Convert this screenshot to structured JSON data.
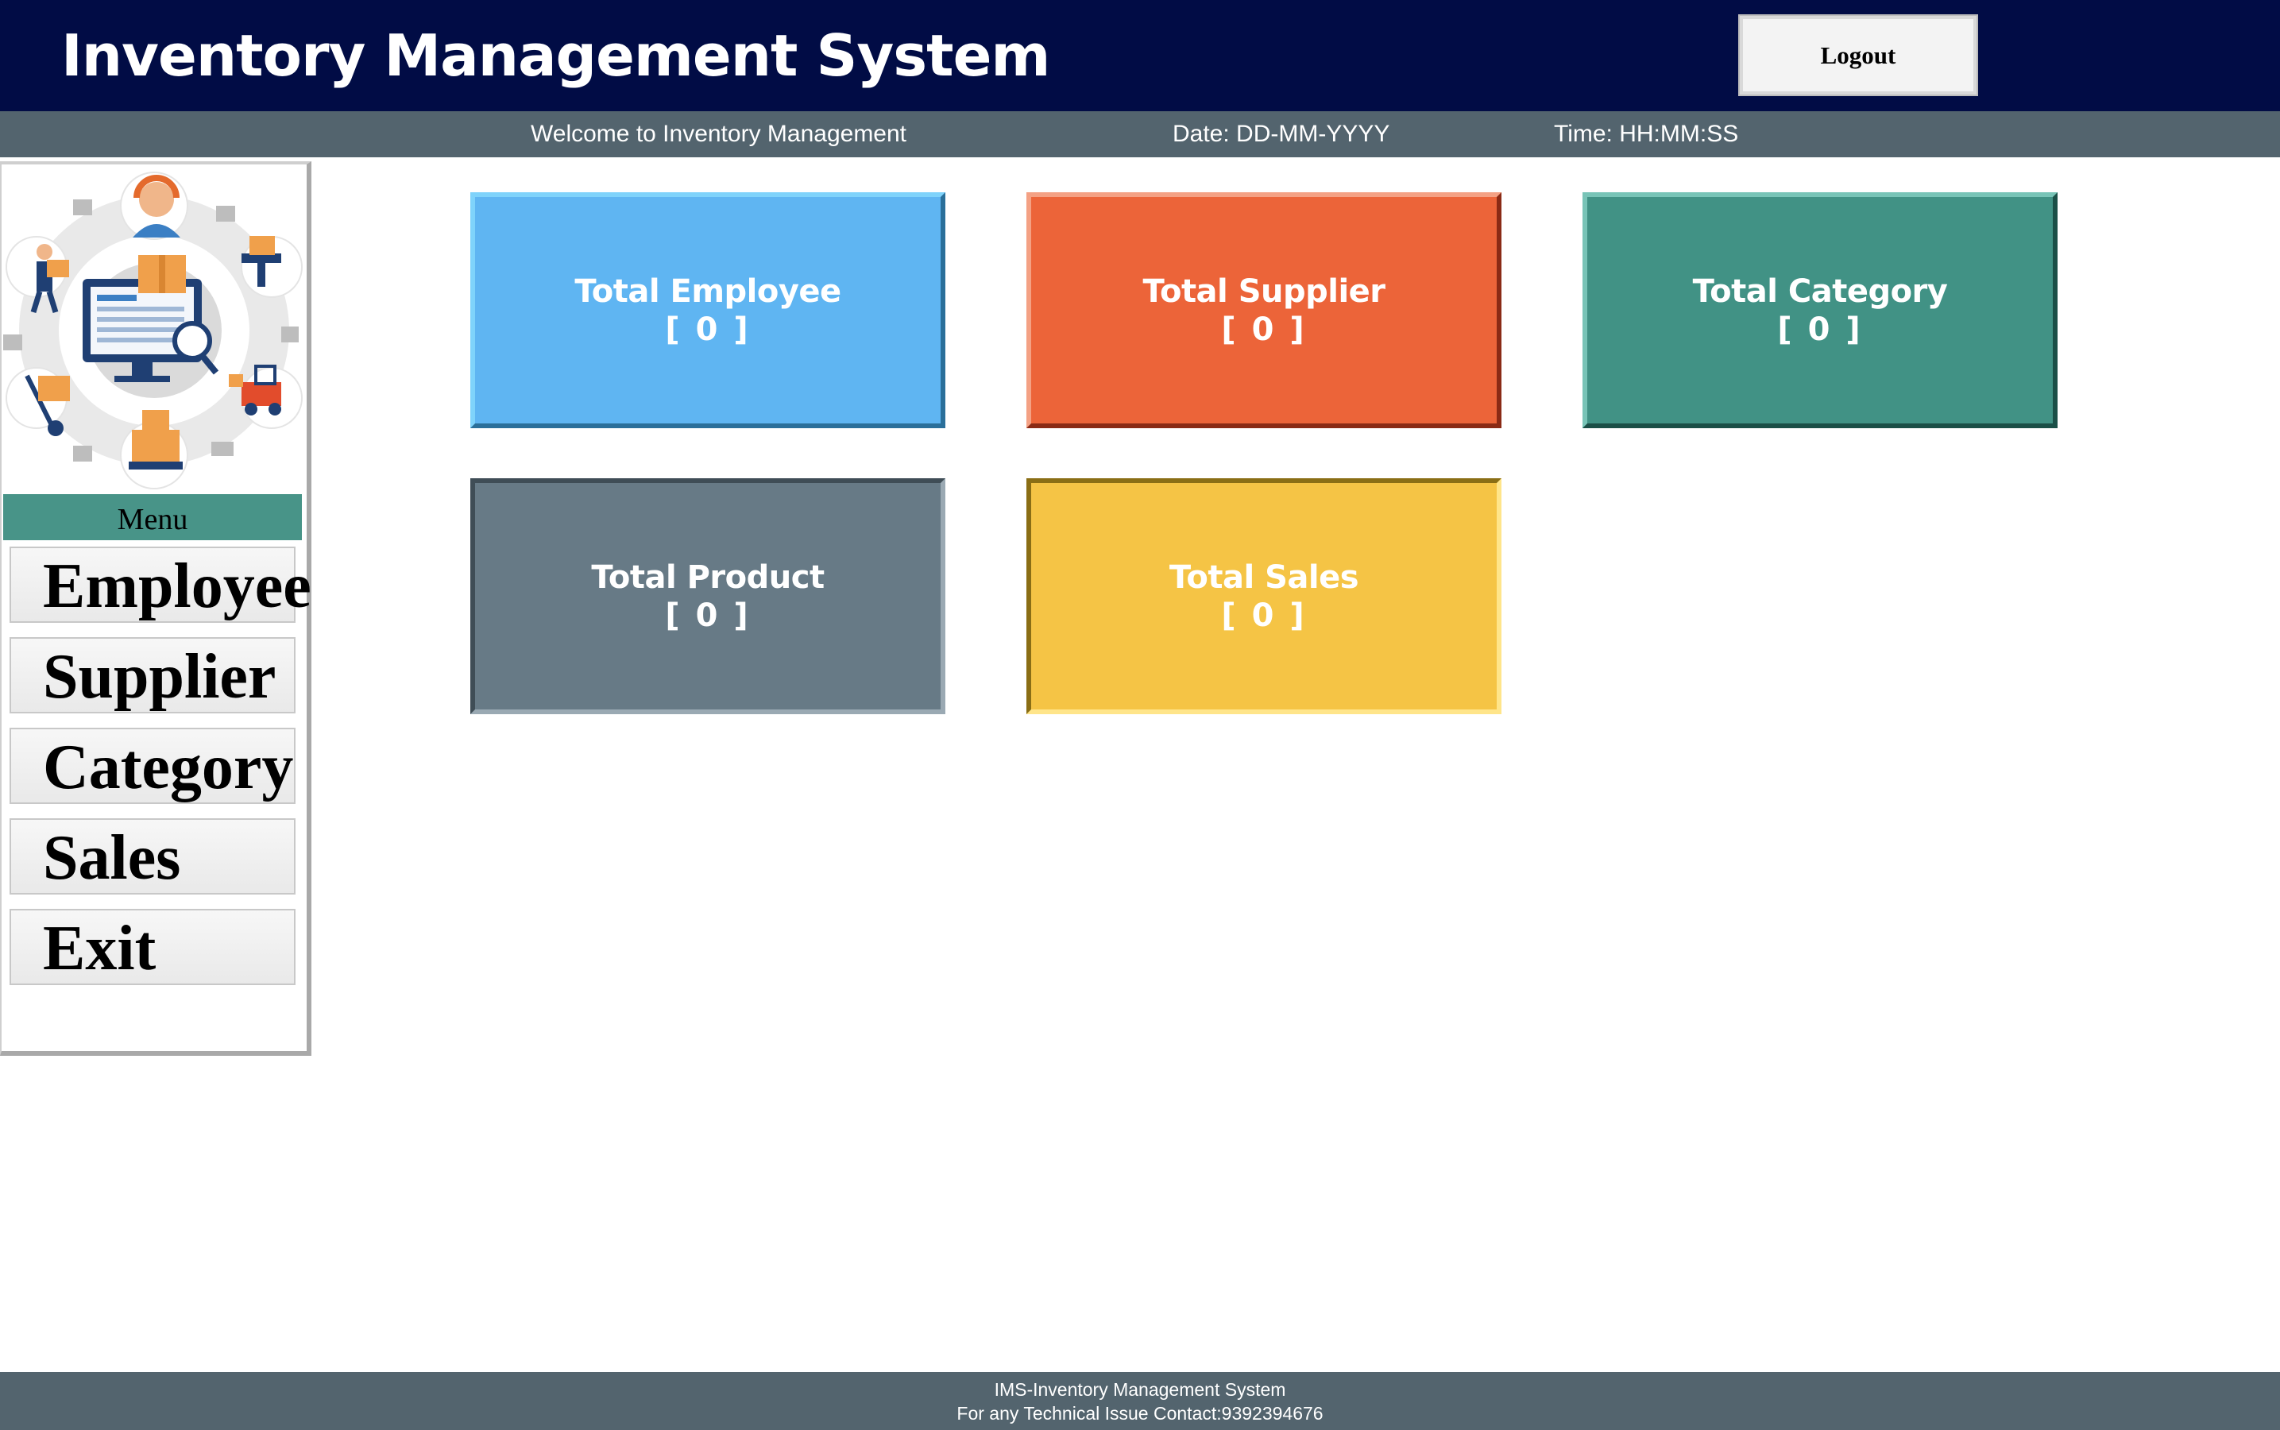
{
  "header": {
    "title": "Inventory Management System",
    "logout_label": "Logout"
  },
  "status": {
    "welcome": "Welcome to Inventory Management",
    "date": "Date: DD-MM-YYYY",
    "time": "Time: HH:MM:SS"
  },
  "sidebar": {
    "logo_icon": "inventory-illustration-icon",
    "menu_label": "Menu",
    "items": [
      {
        "label": "Employee"
      },
      {
        "label": "Supplier"
      },
      {
        "label": "Category"
      },
      {
        "label": "Sales"
      },
      {
        "label": "Exit"
      }
    ]
  },
  "cards": [
    {
      "title": "Total Employee",
      "value": "[ 0 ]",
      "color": "#5fb5f2"
    },
    {
      "title": "Total Supplier",
      "value": "[ 0 ]",
      "color": "#ec6439"
    },
    {
      "title": "Total Category",
      "value": "[ 0 ]",
      "color": "#419285"
    },
    {
      "title": "Total Product",
      "value": "[ 0 ]",
      "color": "#677a86"
    },
    {
      "title": "Total Sales",
      "value": "[ 0 ]",
      "color": "#f5c445"
    }
  ],
  "footer": {
    "line1": "IMS-Inventory Management System",
    "line2": "For any Technical Issue Contact:9392394676"
  },
  "colors": {
    "titlebar": "#010c45",
    "statusbar": "#53646e",
    "menu_header": "#489488"
  }
}
